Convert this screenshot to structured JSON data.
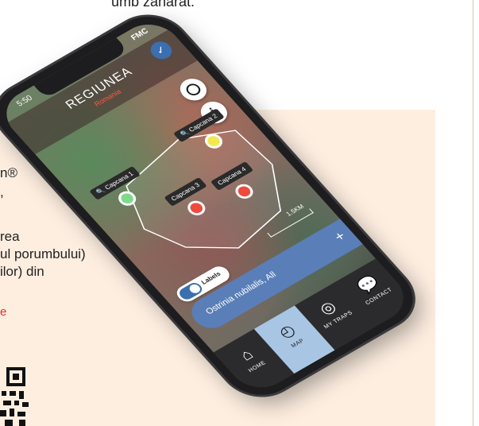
{
  "page": {
    "top_text": "umb zănarat.",
    "side_lines": [
      "n®",
      ",",
      "rea",
      "ul porumbului)",
      "ilor) din"
    ],
    "link_text": "e"
  },
  "app": {
    "status": {
      "time": "5:50",
      "brand": "FMC"
    },
    "header": {
      "title": "REGIUNEA",
      "subtitle": "Romania"
    },
    "traps": [
      {
        "label": "Capcana 1",
        "color": "#7ed98a"
      },
      {
        "label": "Capcana 2",
        "color": "#f2e94e"
      },
      {
        "label": "Capcana 3",
        "color": "#ef4a3e"
      },
      {
        "label": "Capcana 4",
        "color": "#ef4a3e"
      }
    ],
    "labels_toggle": "Labels",
    "scale": "1.5KM",
    "species": {
      "text": "Ostrinia nubilalis, All",
      "add": "+"
    },
    "tabs": [
      {
        "label": "HOME",
        "icon": "⌂"
      },
      {
        "label": "MAP",
        "icon": "◴"
      },
      {
        "label": "MY TRAPS",
        "icon": "◎"
      },
      {
        "label": "CONTACT",
        "icon": "💬"
      }
    ],
    "colors": {
      "accent": "#3b6fb0",
      "active_tab": "#a8c6e3",
      "tabbar": "#2b2b2d"
    }
  }
}
